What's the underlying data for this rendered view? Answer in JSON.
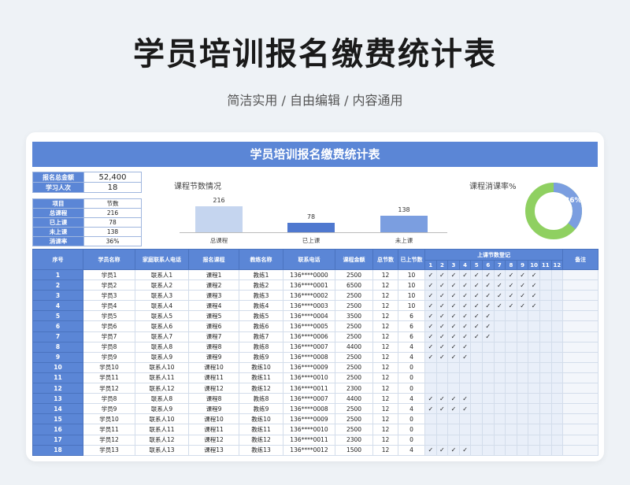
{
  "header": {
    "title": "学员培训报名缴费统计表",
    "subtitle": "简洁实用 / 自由编辑 / 内容通用"
  },
  "sheet": {
    "title": "学员培训报名缴费统计表"
  },
  "summary": {
    "total_fee_label": "报名总金额",
    "total_fee_value": "52,400",
    "students_label": "学习人次",
    "students_value": "18"
  },
  "lesson_summary": {
    "header_item": "项目",
    "header_count": "节数",
    "rows": [
      {
        "label": "总课程",
        "value": "216"
      },
      {
        "label": "已上课",
        "value": "78"
      },
      {
        "label": "未上课",
        "value": "138"
      },
      {
        "label": "消课率",
        "value": "36%"
      }
    ]
  },
  "bar_chart": {
    "title": "课程节数情况"
  },
  "donut": {
    "title": "课程消课率%",
    "label": "36%",
    "value": 0.36,
    "colors": {
      "fill": "#7b9ee0",
      "rest": "#8fd061"
    }
  },
  "chart_data": [
    {
      "type": "bar",
      "title": "课程节数情况",
      "categories": [
        "总课程",
        "已上课",
        "未上课"
      ],
      "values": [
        216,
        78,
        138
      ],
      "colors": [
        "#c5d5ef",
        "#4f78cf",
        "#7b9ee0"
      ],
      "ylim": [
        0,
        216
      ]
    },
    {
      "type": "pie",
      "title": "课程消课率%",
      "categories": [
        "已上课"
      ],
      "values": [
        36
      ]
    }
  ],
  "table": {
    "headers": [
      "序号",
      "学员名称",
      "家庭联系人电话",
      "报名课程",
      "教练名称",
      "联系电话",
      "课程金额",
      "总节数",
      "已上节数",
      "上课节数登记",
      "备注"
    ],
    "lesson_numbers": [
      "1",
      "2",
      "3",
      "4",
      "5",
      "6",
      "7",
      "8",
      "9",
      "10",
      "11",
      "12"
    ],
    "check_mark": "✓",
    "rows": [
      {
        "no": "1",
        "student": "学员1",
        "contact": "联系人1",
        "course": "课程1",
        "coach": "教练1",
        "phone": "136****0000",
        "fee": "2500",
        "total": "12",
        "done": "10"
      },
      {
        "no": "2",
        "student": "学员2",
        "contact": "联系人2",
        "course": "课程2",
        "coach": "教练2",
        "phone": "136****0001",
        "fee": "6500",
        "total": "12",
        "done": "10"
      },
      {
        "no": "3",
        "student": "学员3",
        "contact": "联系人3",
        "course": "课程3",
        "coach": "教练3",
        "phone": "136****0002",
        "fee": "2500",
        "total": "12",
        "done": "10"
      },
      {
        "no": "4",
        "student": "学员4",
        "contact": "联系人4",
        "course": "课程4",
        "coach": "教练4",
        "phone": "136****0003",
        "fee": "2500",
        "total": "12",
        "done": "10"
      },
      {
        "no": "5",
        "student": "学员5",
        "contact": "联系人5",
        "course": "课程5",
        "coach": "教练5",
        "phone": "136****0004",
        "fee": "3500",
        "total": "12",
        "done": "6"
      },
      {
        "no": "6",
        "student": "学员6",
        "contact": "联系人6",
        "course": "课程6",
        "coach": "教练6",
        "phone": "136****0005",
        "fee": "2500",
        "total": "12",
        "done": "6"
      },
      {
        "no": "7",
        "student": "学员7",
        "contact": "联系人7",
        "course": "课程7",
        "coach": "教练7",
        "phone": "136****0006",
        "fee": "2500",
        "total": "12",
        "done": "6"
      },
      {
        "no": "8",
        "student": "学员8",
        "contact": "联系人8",
        "course": "课程8",
        "coach": "教练8",
        "phone": "136****0007",
        "fee": "4400",
        "total": "12",
        "done": "4"
      },
      {
        "no": "9",
        "student": "学员9",
        "contact": "联系人9",
        "course": "课程9",
        "coach": "教练9",
        "phone": "136****0008",
        "fee": "2500",
        "total": "12",
        "done": "4"
      },
      {
        "no": "10",
        "student": "学员10",
        "contact": "联系人10",
        "course": "课程10",
        "coach": "教练10",
        "phone": "136****0009",
        "fee": "2500",
        "total": "12",
        "done": "0"
      },
      {
        "no": "11",
        "student": "学员11",
        "contact": "联系人11",
        "course": "课程11",
        "coach": "教练11",
        "phone": "136****0010",
        "fee": "2500",
        "total": "12",
        "done": "0"
      },
      {
        "no": "12",
        "student": "学员12",
        "contact": "联系人12",
        "course": "课程12",
        "coach": "教练12",
        "phone": "136****0011",
        "fee": "2300",
        "total": "12",
        "done": "0"
      },
      {
        "no": "13",
        "student": "学员8",
        "contact": "联系人8",
        "course": "课程8",
        "coach": "教练8",
        "phone": "136****0007",
        "fee": "4400",
        "total": "12",
        "done": "4"
      },
      {
        "no": "14",
        "student": "学员9",
        "contact": "联系人9",
        "course": "课程9",
        "coach": "教练9",
        "phone": "136****0008",
        "fee": "2500",
        "total": "12",
        "done": "4"
      },
      {
        "no": "15",
        "student": "学员10",
        "contact": "联系人10",
        "course": "课程10",
        "coach": "教练10",
        "phone": "136****0009",
        "fee": "2500",
        "total": "12",
        "done": "0"
      },
      {
        "no": "16",
        "student": "学员11",
        "contact": "联系人11",
        "course": "课程11",
        "coach": "教练11",
        "phone": "136****0010",
        "fee": "2500",
        "total": "12",
        "done": "0"
      },
      {
        "no": "17",
        "student": "学员12",
        "contact": "联系人12",
        "course": "课程12",
        "coach": "教练12",
        "phone": "136****0011",
        "fee": "2300",
        "total": "12",
        "done": "0"
      },
      {
        "no": "18",
        "student": "学员13",
        "contact": "联系人13",
        "course": "课程13",
        "coach": "教练13",
        "phone": "136****0012",
        "fee": "1500",
        "total": "12",
        "done": "4"
      }
    ]
  }
}
